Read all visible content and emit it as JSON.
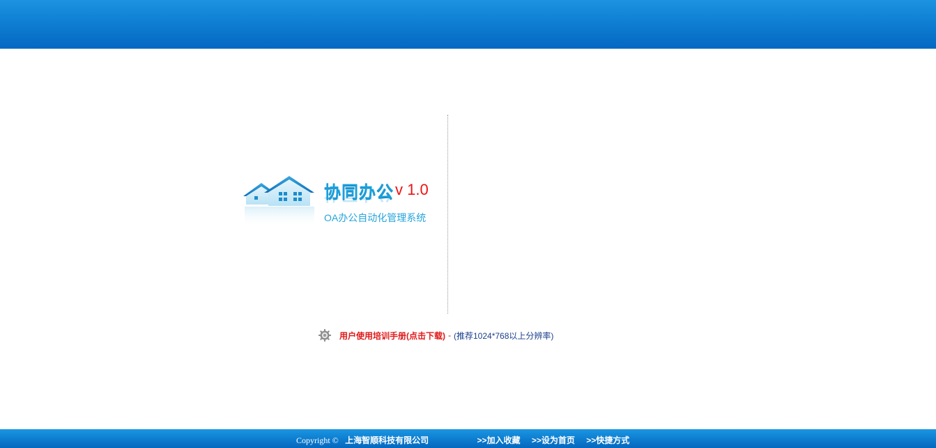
{
  "logo": {
    "title": "协同办公",
    "version": "v 1.0",
    "subtitle": "OA办公自动化管理系统"
  },
  "manual": {
    "link_label": "用户使用培训手册(点击下载)",
    "separator": "-",
    "note": "(推荐1024*768以上分辨率)",
    "icon": "gear-icon"
  },
  "footer": {
    "copyright": "Copyright ©",
    "company": "上海智顺科技有限公司",
    "links": [
      {
        "label": ">>加入收藏"
      },
      {
        "label": ">>设为首页"
      },
      {
        "label": ">>快捷方式"
      }
    ]
  },
  "colors": {
    "banner": "#0f7fd3",
    "accent_red": "#e01818",
    "logo_blue": "#1aa0dc"
  }
}
